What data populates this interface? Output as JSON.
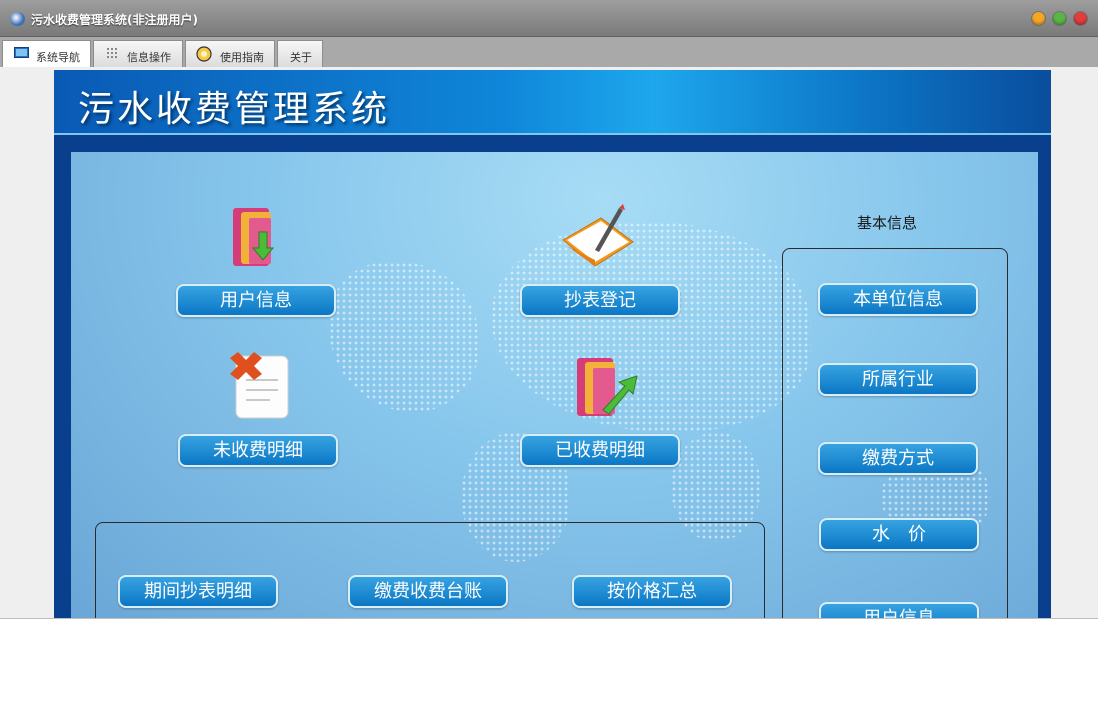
{
  "window": {
    "title": "污水收费管理系统(非注册用户)",
    "controls": [
      "minimize",
      "maximize",
      "close"
    ]
  },
  "tabs": [
    {
      "label": "系统导航",
      "icon": "monitor-icon",
      "active": true
    },
    {
      "label": "信息操作",
      "icon": "grid-icon",
      "active": false
    },
    {
      "label": "使用指南",
      "icon": "help-circle-icon",
      "active": false
    },
    {
      "label": "关于",
      "icon": "",
      "active": false
    }
  ],
  "banner": {
    "title": "污水收费管理系统"
  },
  "main": {
    "buttons": {
      "user_info": "用户信息",
      "meter_reading": "抄表登记",
      "unpaid_detail": "未收费明细",
      "paid_detail": "已收费明细"
    },
    "reports": {
      "period_reading": "期间抄表明细",
      "payment_ledger": "缴费收费台账",
      "price_summary": "按价格汇总"
    }
  },
  "basic_info": {
    "heading": "基本信息",
    "items": [
      "本单位信息",
      "所属行业",
      "缴费方式",
      "水　价",
      "用户信息"
    ]
  },
  "colors": {
    "title_bar": "#8c8c8c",
    "button_blue": "#1587d2",
    "banner_blue": "#0f86d9",
    "panel_blue": "#87c6ec"
  }
}
